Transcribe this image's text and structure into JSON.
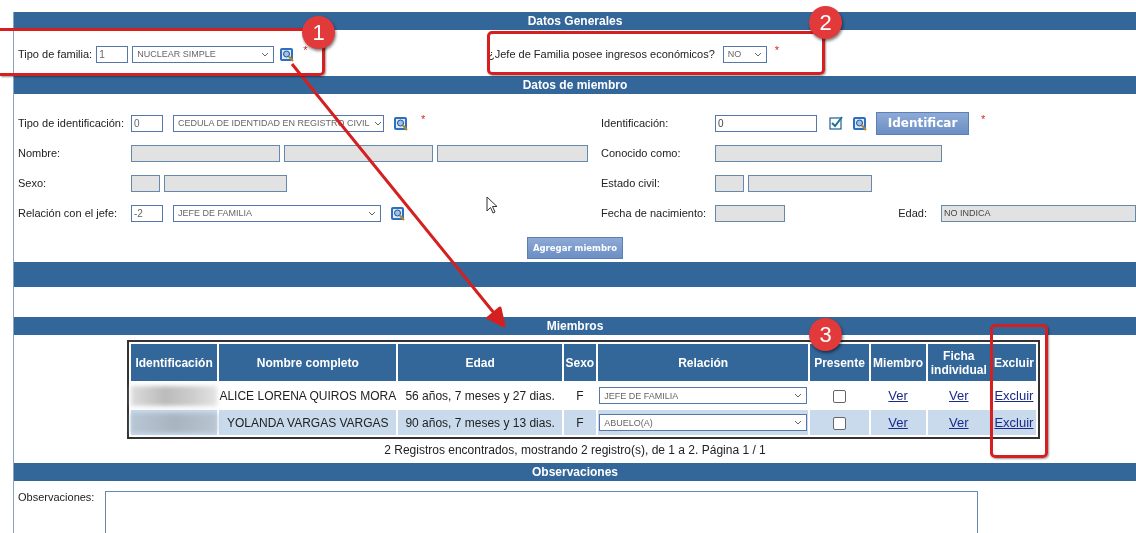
{
  "general": {
    "title": "Datos Generales",
    "tipo_familia": {
      "label": "Tipo de familia:",
      "code": "1",
      "value": "NUCLEAR SIMPLE",
      "required": "*"
    },
    "ingresos": {
      "label": "¿Jefe de Familia posee ingresos económicos?",
      "value": "NO",
      "required": "*"
    }
  },
  "miembro": {
    "title": "Datos de miembro",
    "tipo_identificacion": {
      "label": "Tipo de identificación:",
      "code": "0",
      "value": "CEDULA DE IDENTIDAD EN REGISTRO CIVIL",
      "required": "*"
    },
    "identificacion": {
      "label": "Identificación:",
      "value": "0",
      "checked": true,
      "button": "Identificar",
      "required": "*"
    },
    "nombre": {
      "label": "Nombre:"
    },
    "conocido": {
      "label": "Conocido como:"
    },
    "sexo": {
      "label": "Sexo:"
    },
    "estado_civil": {
      "label": "Estado civil:"
    },
    "relacion": {
      "label": "Relación con el jefe:",
      "code": "-2",
      "value": "JEFE DE FAMILIA"
    },
    "fecha": {
      "label": "Fecha de nacimiento:"
    },
    "edad": {
      "label": "Edad:",
      "value": "NO INDICA"
    },
    "add_button": "Agregar miembro"
  },
  "miembros": {
    "title": "Miembros",
    "columns": [
      "Identificación",
      "Nombre completo",
      "Edad",
      "Sexo",
      "Relación",
      "Presente",
      "Miembro",
      "Ficha individual",
      "Excluir"
    ],
    "rows": [
      {
        "id_redacted": true,
        "nombre": "ALICE LORENA QUIROS MORA",
        "edad": "56 años, 7 meses y 27 dias.",
        "sexo": "F",
        "relacion": "JEFE DE FAMILIA",
        "presente": false,
        "miembro": "Ver",
        "ficha": "Ver",
        "excluir": "Excluir"
      },
      {
        "id_redacted": true,
        "nombre": "YOLANDA VARGAS VARGAS",
        "edad": "90 años, 7 meses y 13 dias.",
        "sexo": "F",
        "relacion": "ABUELO(A)",
        "presente": false,
        "miembro": "Ver",
        "ficha": "Ver",
        "excluir": "Excluir"
      }
    ],
    "summary": "2 Registros encontrados, mostrando 2 registro(s), de 1 a 2. Página 1 / 1"
  },
  "observaciones": {
    "title": "Observaciones",
    "label": "Observaciones:"
  },
  "annotations": [
    {
      "number": "1"
    },
    {
      "number": "2"
    },
    {
      "number": "3"
    }
  ]
}
